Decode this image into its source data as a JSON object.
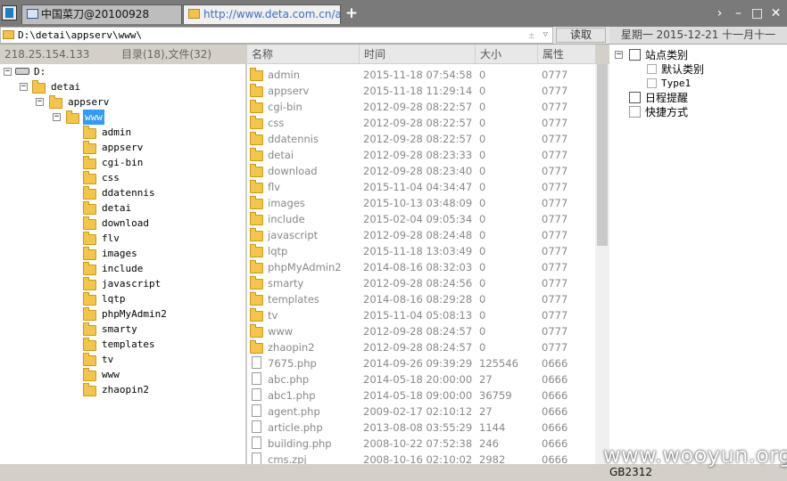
{
  "tabs": [
    {
      "label": "中国菜刀@20100928",
      "active": false
    },
    {
      "label": "http://www.deta.com.cn/abc...",
      "active": true
    }
  ],
  "new_tab_label": "+",
  "window_controls": {
    "chevron": "chevron-right-icon",
    "minimize": "–",
    "restore": "□",
    "close": "✕"
  },
  "address": {
    "path": "D:\\detai\\appserv\\www\\",
    "add_symbol": "±",
    "dropdown_symbol": "▽",
    "read_button": "读取"
  },
  "date_display": "星期一 2015-12-21 十一月十一",
  "left_header": {
    "ip": "218.25.154.133",
    "counts": "目录(18),文件(32)"
  },
  "tree": {
    "drive": "D:",
    "level1": "detai",
    "level2": "appserv",
    "level3": "www",
    "children": [
      "admin",
      "appserv",
      "cgi-bin",
      "css",
      "ddatennis",
      "detai",
      "download",
      "flv",
      "images",
      "include",
      "javascript",
      "lqtp",
      "phpMyAdmin2",
      "smarty",
      "templates",
      "tv",
      "www",
      "zhaopin2"
    ]
  },
  "list_columns": {
    "name": "名称",
    "time": "时间",
    "size": "大小",
    "perm": "属性"
  },
  "files": [
    {
      "name": "admin",
      "time": "2015-11-18 07:54:58",
      "size": "0",
      "perm": "0777",
      "type": "folder"
    },
    {
      "name": "appserv",
      "time": "2015-11-18 11:29:14",
      "size": "0",
      "perm": "0777",
      "type": "folder"
    },
    {
      "name": "cgi-bin",
      "time": "2012-09-28 08:22:57",
      "size": "0",
      "perm": "0777",
      "type": "folder"
    },
    {
      "name": "css",
      "time": "2012-09-28 08:22:57",
      "size": "0",
      "perm": "0777",
      "type": "folder"
    },
    {
      "name": "ddatennis",
      "time": "2012-09-28 08:22:57",
      "size": "0",
      "perm": "0777",
      "type": "folder"
    },
    {
      "name": "detai",
      "time": "2012-09-28 08:23:33",
      "size": "0",
      "perm": "0777",
      "type": "folder"
    },
    {
      "name": "download",
      "time": "2012-09-28 08:23:40",
      "size": "0",
      "perm": "0777",
      "type": "folder"
    },
    {
      "name": "flv",
      "time": "2015-11-04 04:34:47",
      "size": "0",
      "perm": "0777",
      "type": "folder"
    },
    {
      "name": "images",
      "time": "2015-10-13 03:48:09",
      "size": "0",
      "perm": "0777",
      "type": "folder"
    },
    {
      "name": "include",
      "time": "2015-02-04 09:05:34",
      "size": "0",
      "perm": "0777",
      "type": "folder"
    },
    {
      "name": "javascript",
      "time": "2012-09-28 08:24:48",
      "size": "0",
      "perm": "0777",
      "type": "folder"
    },
    {
      "name": "lqtp",
      "time": "2015-11-18 13:03:49",
      "size": "0",
      "perm": "0777",
      "type": "folder"
    },
    {
      "name": "phpMyAdmin2",
      "time": "2014-08-16 08:32:03",
      "size": "0",
      "perm": "0777",
      "type": "folder"
    },
    {
      "name": "smarty",
      "time": "2012-09-28 08:24:56",
      "size": "0",
      "perm": "0777",
      "type": "folder"
    },
    {
      "name": "templates",
      "time": "2014-08-16 08:29:28",
      "size": "0",
      "perm": "0777",
      "type": "folder"
    },
    {
      "name": "tv",
      "time": "2015-11-04 05:08:13",
      "size": "0",
      "perm": "0777",
      "type": "folder"
    },
    {
      "name": "www",
      "time": "2012-09-28 08:24:57",
      "size": "0",
      "perm": "0777",
      "type": "folder"
    },
    {
      "name": "zhaopin2",
      "time": "2012-09-28 08:24:57",
      "size": "0",
      "perm": "0777",
      "type": "folder"
    },
    {
      "name": "7675.php",
      "time": "2014-09-26 09:39:29",
      "size": "125546",
      "perm": "0666",
      "type": "file"
    },
    {
      "name": "abc.php",
      "time": "2014-05-18 20:00:00",
      "size": "27",
      "perm": "0666",
      "type": "file"
    },
    {
      "name": "abc1.php",
      "time": "2014-05-18 09:00:00",
      "size": "36759",
      "perm": "0666",
      "type": "file"
    },
    {
      "name": "agent.php",
      "time": "2009-02-17 02:10:12",
      "size": "27",
      "perm": "0666",
      "type": "file"
    },
    {
      "name": "article.php",
      "time": "2013-08-08 03:55:29",
      "size": "1144",
      "perm": "0666",
      "type": "file"
    },
    {
      "name": "building.php",
      "time": "2008-10-22 07:52:38",
      "size": "246",
      "perm": "0666",
      "type": "file"
    },
    {
      "name": "cms.zpj",
      "time": "2008-10-16 02:10:02",
      "size": "2982",
      "perm": "0666",
      "type": "file"
    }
  ],
  "right_tree": {
    "root": "站点类别",
    "default_category": "默认类别",
    "type1": "Type1",
    "schedule": "日程提醒",
    "shortcuts": "快捷方式"
  },
  "status": {
    "encoding": "GB2312"
  },
  "watermark": "www.wooyun.org"
}
